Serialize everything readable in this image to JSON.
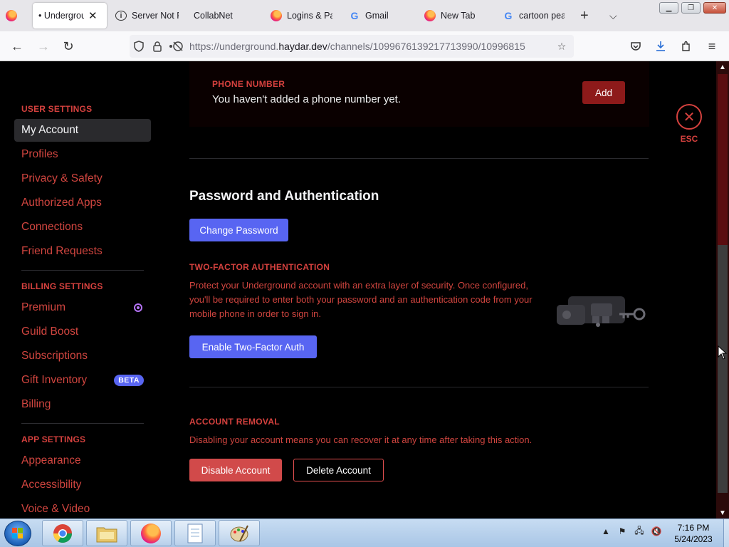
{
  "browser": {
    "tabs": [
      {
        "title": "• Undergroun",
        "icon": "firefox",
        "active": true
      },
      {
        "title": "Server Not F",
        "icon": "info"
      },
      {
        "title": "CollabNet",
        "icon": "none"
      },
      {
        "title": "Logins & Pa",
        "icon": "firefox"
      },
      {
        "title": "Gmail",
        "icon": "google"
      },
      {
        "title": "New Tab",
        "icon": "firefox"
      },
      {
        "title": "cartoon pea",
        "icon": "google"
      }
    ],
    "url_prefix": "https://underground.",
    "url_domain": "haydar.dev",
    "url_path": "/channels/1099676139217713990/10996815"
  },
  "sidebar": {
    "user_settings_header": "USER SETTINGS",
    "user_items": [
      "My Account",
      "Profiles",
      "Privacy & Safety",
      "Authorized Apps",
      "Connections",
      "Friend Requests"
    ],
    "billing_header": "BILLING SETTINGS",
    "billing_items": [
      "Premium",
      "Guild Boost",
      "Subscriptions",
      "Gift Inventory",
      "Billing"
    ],
    "beta_badge": "BETA",
    "app_header": "APP SETTINGS",
    "app_items": [
      "Appearance",
      "Accessibility",
      "Voice & Video"
    ]
  },
  "content": {
    "phone_label": "PHONE NUMBER",
    "phone_text": "You haven't added a phone number yet.",
    "add_button": "Add",
    "pw_heading": "Password and Authentication",
    "change_password": "Change Password",
    "twofa_label": "TWO-FACTOR AUTHENTICATION",
    "twofa_desc": "Protect your Underground account with an extra layer of security. Once configured, you'll be required to enter both your password and an authentication code from your mobile phone in order to sign in.",
    "enable_2fa": "Enable Two-Factor Auth",
    "removal_label": "ACCOUNT REMOVAL",
    "removal_desc": "Disabling your account means you can recover it at any time after taking this action.",
    "disable_account": "Disable Account",
    "delete_account": "Delete Account"
  },
  "esc_label": "ESC",
  "taskbar": {
    "time": "7:16 PM",
    "date": "5/24/2023"
  }
}
